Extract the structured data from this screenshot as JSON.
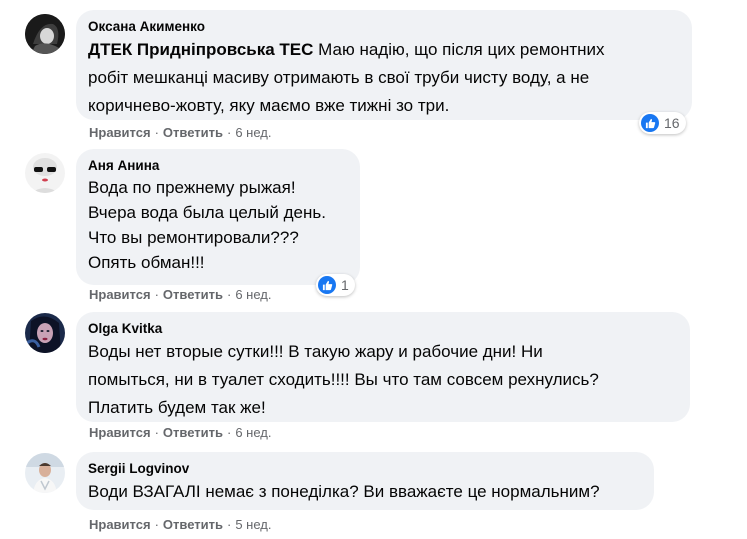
{
  "comments": [
    {
      "author": "Оксана Акименко",
      "tag": "ДТЕК Придніпровська ТЕС",
      "lines": [
        " Маю надію, що після цих ремонтних",
        "робіт мешканці масиву отримають в свої труби чисту воду, а не",
        "коричнево-жовту, яку маємо вже тижні зо три."
      ],
      "like_label": "Нравится",
      "reply_label": "Ответить",
      "time": "6 нед.",
      "reactions": "16"
    },
    {
      "author": "Аня Анина",
      "lines": [
        "Вода по прежнему рыжая!",
        "Вчера вода была целый день.",
        "Что вы ремонтировали???",
        "Опять обман!!!"
      ],
      "like_label": "Нравится",
      "reply_label": "Ответить",
      "time": "6 нед.",
      "reactions": "1"
    },
    {
      "author": "Olga Kvitka",
      "lines": [
        "Воды нет вторые сутки!!! В такую жару и рабочие дни! Ни",
        "помыться, ни в туалет сходить!!!! Вы что там совсем рехнулись?",
        "Платить будем так же!"
      ],
      "like_label": "Нравится",
      "reply_label": "Ответить",
      "time": "6 нед."
    },
    {
      "author": "Sergii Logvinov",
      "lines": [
        "Води ВЗАГАЛІ немає з понеділка? Ви вважаєте це нормальним?"
      ],
      "like_label": "Нравится",
      "reply_label": "Ответить",
      "time": "5 нед."
    }
  ],
  "colors": {
    "bubble": "#f0f2f5",
    "like_blue": "#1877f2",
    "meta_gray": "#65676b"
  },
  "icons": [
    "like-reaction-icon"
  ]
}
